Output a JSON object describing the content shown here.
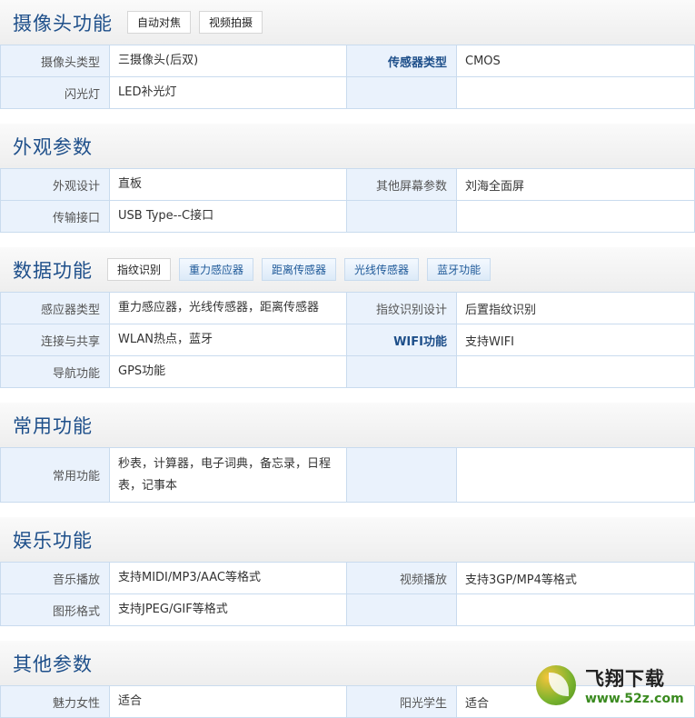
{
  "sections": [
    {
      "title": "摄像头功能",
      "tags": [
        {
          "label": "自动对焦",
          "style": "plain"
        },
        {
          "label": "视频拍摄",
          "style": "plain"
        }
      ],
      "rows": [
        {
          "l1": "摄像头类型",
          "v1": "三摄像头(后双)",
          "l2": "传感器类型",
          "l2bold": true,
          "v2": "CMOS"
        },
        {
          "l1": "闪光灯",
          "v1": "LED补光灯",
          "l2": "",
          "v2": ""
        }
      ]
    },
    {
      "title": "外观参数",
      "tags": [],
      "rows": [
        {
          "l1": "外观设计",
          "v1": "直板",
          "l2": "其他屏幕参数",
          "v2": "刘海全面屏"
        },
        {
          "l1": "传输接口",
          "v1": "USB Type--C接口",
          "l2": "",
          "v2": ""
        }
      ]
    },
    {
      "title": "数据功能",
      "tags": [
        {
          "label": "指纹识别",
          "style": "plain"
        },
        {
          "label": "重力感应器",
          "style": "blue"
        },
        {
          "label": "距离传感器",
          "style": "blue"
        },
        {
          "label": "光线传感器",
          "style": "blue"
        },
        {
          "label": "蓝牙功能",
          "style": "blue"
        }
      ],
      "rows": [
        {
          "l1": "感应器类型",
          "v1": "重力感应器，光线传感器，距离传感器",
          "l2": "指纹识别设计",
          "v2": "后置指纹识别"
        },
        {
          "l1": "连接与共享",
          "v1": "WLAN热点，蓝牙",
          "l2": "WIFI功能",
          "l2bold": true,
          "v2": "支持WIFI"
        },
        {
          "l1": "导航功能",
          "v1": "GPS功能",
          "l2": "",
          "v2": ""
        }
      ]
    },
    {
      "title": "常用功能",
      "tags": [],
      "rows": [
        {
          "l1": "常用功能",
          "v1": "秒表，计算器，电子词典，备忘录，日程表，记事本",
          "l2": "",
          "v2": "",
          "tall": true
        }
      ]
    },
    {
      "title": "娱乐功能",
      "tags": [],
      "rows": [
        {
          "l1": "音乐播放",
          "v1": "支持MIDI/MP3/AAC等格式",
          "l2": "视频播放",
          "v2": "支持3GP/MP4等格式"
        },
        {
          "l1": "图形格式",
          "v1": "支持JPEG/GIF等格式",
          "l2": "",
          "v2": ""
        }
      ]
    },
    {
      "title": "其他参数",
      "tags": [],
      "rows": [
        {
          "l1": "魅力女性",
          "v1": "适合",
          "l2": "阳光学生",
          "v2": "适合"
        }
      ]
    }
  ],
  "watermark": {
    "name": "飞翔下载",
    "url": "www.52z.com"
  }
}
